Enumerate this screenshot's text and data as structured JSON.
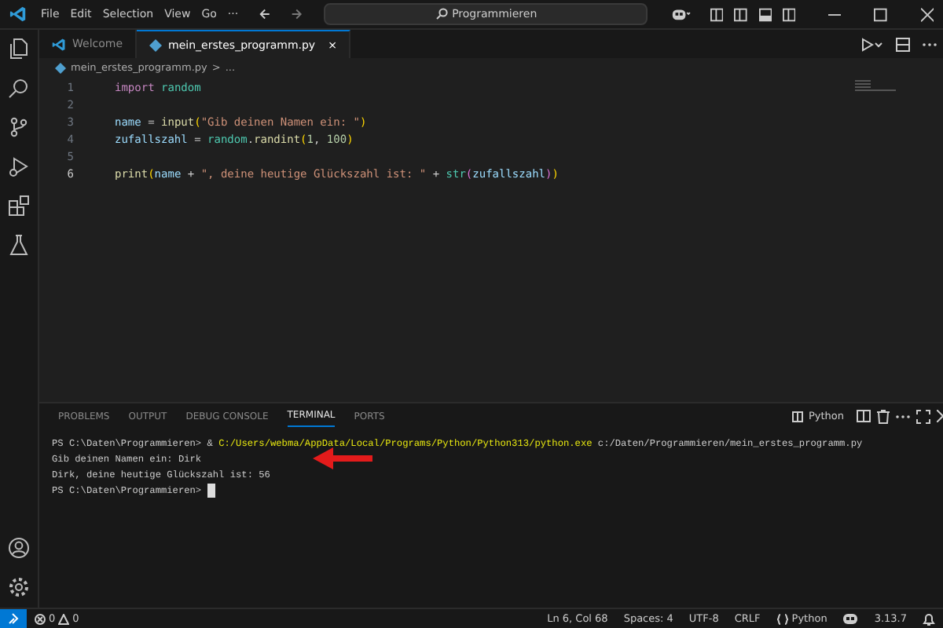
{
  "title_bar": {
    "menu": [
      "File",
      "Edit",
      "Selection",
      "View",
      "Go",
      "···"
    ],
    "search": "Programmieren"
  },
  "tabs": [
    {
      "label": "Welcome",
      "kind": "welcome",
      "selected": false
    },
    {
      "label": "mein_erstes_programm.py",
      "kind": "python",
      "selected": true,
      "close": "×"
    }
  ],
  "breadcrumb": [
    "mein_erstes_programm.py",
    ">",
    "..."
  ],
  "editor": {
    "lines": [
      {
        "number": "1",
        "active": false,
        "tokens": [
          {
            "t": "import",
            "kind": "keyword"
          },
          {
            "t": " random",
            "kind": "module"
          }
        ]
      },
      {
        "number": "2",
        "active": false
      },
      {
        "number": "3",
        "active": false,
        "tokens": [
          {
            "t": "name",
            "kind": "var"
          },
          {
            "t": " = ",
            "kind": "plain"
          },
          {
            "t": "input",
            "kind": "func"
          },
          {
            "t": "(",
            "kind": "bracket"
          },
          {
            "t": "\"Gib deinen Namen ein: \"",
            "kind": "string"
          },
          {
            "t": ")",
            "kind": "bracket"
          }
        ]
      },
      {
        "number": "4",
        "active": false,
        "tokens": [
          {
            "t": "zufallszahl",
            "kind": "var"
          },
          {
            "t": " = ",
            "kind": "plain"
          },
          {
            "t": "random",
            "kind": "module"
          },
          {
            "t": ".",
            "kind": "plain"
          },
          {
            "t": "randint",
            "kind": "func"
          },
          {
            "t": "(",
            "kind": "bracket"
          },
          {
            "t": "1",
            "kind": "number"
          },
          {
            "t": ", ",
            "kind": "plain"
          },
          {
            "t": "100",
            "kind": "number"
          },
          {
            "t": ")",
            "kind": "bracket"
          }
        ]
      },
      {
        "number": "5",
        "active": false
      },
      {
        "number": "6",
        "active": true,
        "tokens": [
          {
            "t": "print",
            "kind": "func"
          },
          {
            "t": "(",
            "kind": "bracket"
          },
          {
            "t": "name",
            "kind": "var"
          },
          {
            "t": " + ",
            "kind": "plain"
          },
          {
            "t": "\", deine heutige Glückszahl ist: \"",
            "kind": "string"
          },
          {
            "t": " + ",
            "kind": "plain"
          },
          {
            "t": "str",
            "kind": "module"
          },
          {
            "t": "(",
            "kind": "bracket2"
          },
          {
            "t": "zufallszahl",
            "kind": "var"
          },
          {
            "t": ")",
            "kind": "bracket2"
          },
          {
            "t": ")",
            "kind": "bracket"
          }
        ]
      }
    ]
  },
  "panel": {
    "tabs": [
      {
        "label": "PROBLEMS",
        "selected": false
      },
      {
        "label": "OUTPUT",
        "selected": false
      },
      {
        "label": "DEBUG CONSOLE",
        "selected": false
      },
      {
        "label": "TERMINAL",
        "selected": true
      },
      {
        "label": "PORTS",
        "selected": false
      }
    ],
    "terminal_name": "Python",
    "terminal_lines": [
      [
        {
          "t": "PS C:\\Daten\\Programmieren> & ",
          "kind": "plain"
        },
        {
          "t": "C:/Users/webma/AppData/Local/Programs/Python/Python313/python.exe",
          "kind": "path"
        },
        {
          "t": " c:/Daten/Programmieren/mein_erstes_programm.py",
          "kind": "plain"
        }
      ],
      [
        {
          "t": "Gib deinen Namen ein: Dirk",
          "kind": "plain"
        }
      ],
      [
        {
          "t": "Dirk, deine heutige Glückszahl ist: 56",
          "kind": "plain"
        }
      ],
      [
        {
          "t": "PS C:\\Daten\\Programmieren> ",
          "kind": "plain"
        }
      ]
    ]
  },
  "status_bar": {
    "errors": "0",
    "warnings": "0",
    "items": [
      "Ln 6, Col 68",
      "Spaces: 4",
      "UTF-8",
      "CRLF"
    ],
    "language": "Python",
    "version": "3.13.7"
  }
}
